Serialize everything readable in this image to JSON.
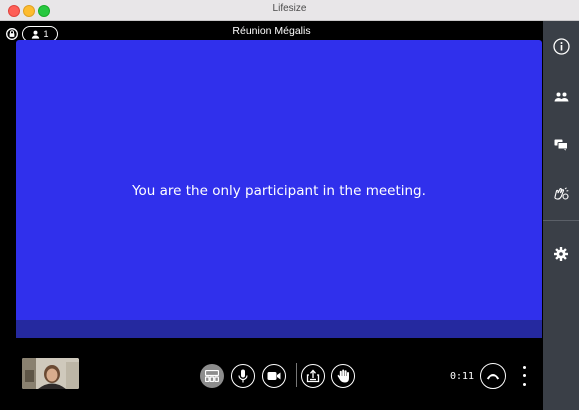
{
  "window": {
    "title": "Lifesize"
  },
  "header": {
    "meeting_title": "Réunion Mégalis",
    "participant_count": "1"
  },
  "stage": {
    "message": "You are the only participant in the meeting."
  },
  "controls": {
    "timer": "0:11",
    "buttons": [
      "layout-icon",
      "microphone-icon",
      "camera-icon",
      "share-screen-icon",
      "raise-hand-icon",
      "hang-up-icon",
      "more-options-icon"
    ]
  },
  "sidebar": {
    "items": [
      "info-icon",
      "participants-icon",
      "chat-icon",
      "reactions-icon",
      "settings-icon"
    ]
  },
  "colors": {
    "stage": "#3030ec",
    "stage_strip": "#25299f",
    "sidebar": "#3a3f47",
    "background": "#000000"
  }
}
